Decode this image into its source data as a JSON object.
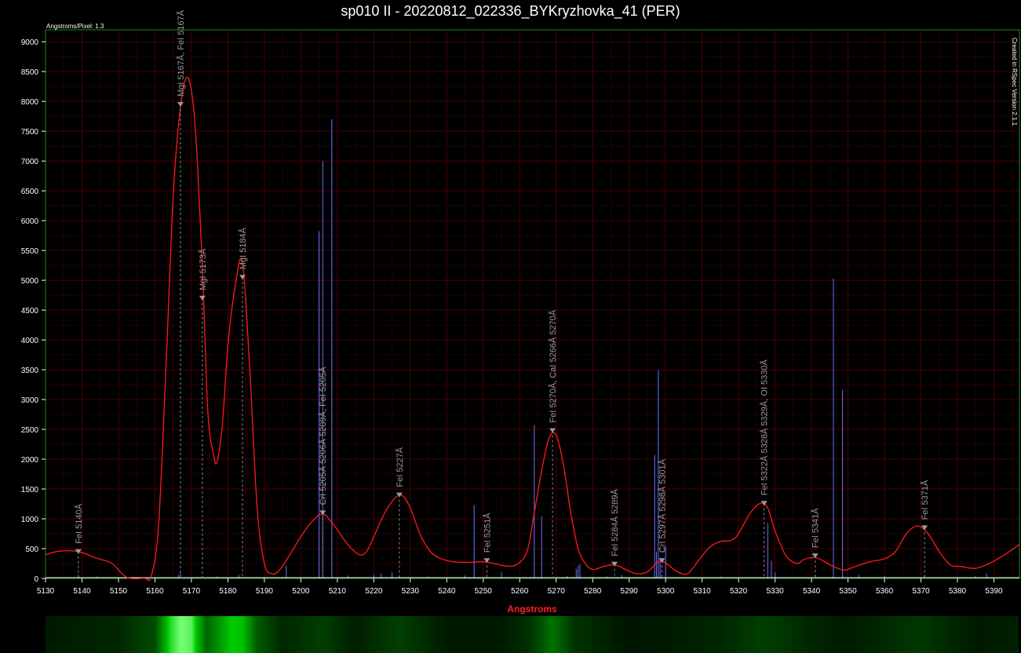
{
  "title": "sp010 II - 20220812_022336_BYKryzhovka_41 (PER)",
  "corner_note": "Angstroms/Pixel: 1.3",
  "side_note": "Created in RSpec Version 2.1.1",
  "colors": {
    "background": "#000000",
    "grid": "#3a0000",
    "spectrum": "#ff1a1a",
    "lines": "#7070ff",
    "axis_label": "#ff2020",
    "markers": "#8a8a8a",
    "frame": "#1f8a1f"
  },
  "chart_data": {
    "type": "line",
    "xlabel": "Angstroms",
    "ylabel": "",
    "xlim": [
      5130,
      5397
    ],
    "ylim": [
      0,
      9200
    ],
    "x_ticks": [
      5130,
      5140,
      5150,
      5160,
      5170,
      5180,
      5190,
      5200,
      5210,
      5220,
      5230,
      5240,
      5250,
      5260,
      5270,
      5280,
      5290,
      5300,
      5310,
      5320,
      5330,
      5340,
      5350,
      5360,
      5370,
      5380,
      5390
    ],
    "y_ticks": [
      0,
      500,
      1000,
      1500,
      2000,
      2500,
      3000,
      3500,
      4000,
      4500,
      5000,
      5500,
      6000,
      6500,
      7000,
      7500,
      8000,
      8500,
      9000
    ],
    "grid": true,
    "spectrum": [
      [
        5130,
        400
      ],
      [
        5134,
        460
      ],
      [
        5139,
        450
      ],
      [
        5144,
        340
      ],
      [
        5148,
        260
      ],
      [
        5151,
        80
      ],
      [
        5153,
        5
      ],
      [
        5157,
        5
      ],
      [
        5159,
        40
      ],
      [
        5161,
        900
      ],
      [
        5163,
        3500
      ],
      [
        5165,
        6400
      ],
      [
        5167,
        7900
      ],
      [
        5169,
        8400
      ],
      [
        5171,
        7600
      ],
      [
        5173,
        5200
      ],
      [
        5174.5,
        2800
      ],
      [
        5176,
        2100
      ],
      [
        5177,
        1950
      ],
      [
        5178.5,
        2600
      ],
      [
        5180,
        3900
      ],
      [
        5182,
        4900
      ],
      [
        5184,
        5300
      ],
      [
        5186,
        3500
      ],
      [
        5188,
        1200
      ],
      [
        5190,
        250
      ],
      [
        5192,
        80
      ],
      [
        5194,
        130
      ],
      [
        5197,
        400
      ],
      [
        5200,
        700
      ],
      [
        5203,
        950
      ],
      [
        5206,
        1080
      ],
      [
        5209,
        900
      ],
      [
        5213,
        560
      ],
      [
        5216,
        400
      ],
      [
        5218,
        450
      ],
      [
        5220,
        700
      ],
      [
        5223,
        1100
      ],
      [
        5226,
        1360
      ],
      [
        5228,
        1380
      ],
      [
        5230,
        1180
      ],
      [
        5233,
        700
      ],
      [
        5236,
        420
      ],
      [
        5240,
        300
      ],
      [
        5245,
        270
      ],
      [
        5250,
        280
      ],
      [
        5253,
        250
      ],
      [
        5256,
        210
      ],
      [
        5259,
        230
      ],
      [
        5262,
        450
      ],
      [
        5264,
        1100
      ],
      [
        5266,
        1800
      ],
      [
        5268,
        2350
      ],
      [
        5270,
        2400
      ],
      [
        5272,
        1900
      ],
      [
        5274,
        1100
      ],
      [
        5276,
        500
      ],
      [
        5278,
        250
      ],
      [
        5280,
        150
      ],
      [
        5283,
        200
      ],
      [
        5286,
        230
      ],
      [
        5289,
        150
      ],
      [
        5292,
        80
      ],
      [
        5295,
        110
      ],
      [
        5298,
        280
      ],
      [
        5300,
        260
      ],
      [
        5303,
        120
      ],
      [
        5306,
        80
      ],
      [
        5309,
        300
      ],
      [
        5312,
        520
      ],
      [
        5315,
        620
      ],
      [
        5318,
        640
      ],
      [
        5320,
        750
      ],
      [
        5323,
        1080
      ],
      [
        5326,
        1260
      ],
      [
        5328,
        1180
      ],
      [
        5330,
        800
      ],
      [
        5333,
        380
      ],
      [
        5336,
        250
      ],
      [
        5338,
        320
      ],
      [
        5341,
        350
      ],
      [
        5343,
        300
      ],
      [
        5346,
        200
      ],
      [
        5349,
        140
      ],
      [
        5352,
        200
      ],
      [
        5356,
        280
      ],
      [
        5360,
        330
      ],
      [
        5363,
        450
      ],
      [
        5366,
        750
      ],
      [
        5369,
        880
      ],
      [
        5372,
        750
      ],
      [
        5375,
        450
      ],
      [
        5378,
        230
      ],
      [
        5381,
        200
      ],
      [
        5385,
        170
      ],
      [
        5389,
        260
      ],
      [
        5393,
        400
      ],
      [
        5397,
        570
      ]
    ],
    "lab_lines": [
      [
        5139,
        60
      ],
      [
        5144,
        30
      ],
      [
        5166.5,
        60
      ],
      [
        5167,
        100
      ],
      [
        5177,
        30
      ],
      [
        5183,
        60
      ],
      [
        5196,
        220
      ],
      [
        5205,
        5820
      ],
      [
        5206,
        7000
      ],
      [
        5208.5,
        7700
      ],
      [
        5213,
        50
      ],
      [
        5220,
        60
      ],
      [
        5222,
        80
      ],
      [
        5225,
        100
      ],
      [
        5227,
        40
      ],
      [
        5235,
        30
      ],
      [
        5245,
        50
      ],
      [
        5247.5,
        1230
      ],
      [
        5255,
        100
      ],
      [
        5264,
        2570
      ],
      [
        5266,
        1040
      ],
      [
        5273,
        40
      ],
      [
        5275.5,
        160
      ],
      [
        5276,
        210
      ],
      [
        5276.5,
        240
      ],
      [
        5284,
        30
      ],
      [
        5288,
        60
      ],
      [
        5297,
        2070
      ],
      [
        5297.5,
        450
      ],
      [
        5298,
        3500
      ],
      [
        5298.5,
        350
      ],
      [
        5300,
        540
      ],
      [
        5315,
        30
      ],
      [
        5328,
        930
      ],
      [
        5329,
        300
      ],
      [
        5330,
        100
      ],
      [
        5346,
        5030
      ],
      [
        5348.5,
        3160
      ],
      [
        5353,
        60
      ],
      [
        5360,
        40
      ],
      [
        5371,
        50
      ],
      [
        5385,
        40
      ],
      [
        5388,
        80
      ]
    ],
    "annotations": [
      {
        "x": 5139,
        "y": 450,
        "label": "FeI 5140Å"
      },
      {
        "x": 5167,
        "y": 7950,
        "label": "MgI 5167Å, FeI 5167Å"
      },
      {
        "x": 5173,
        "y": 4700,
        "label": "MgI 5173Å"
      },
      {
        "x": 5184,
        "y": 5050,
        "label": "MgI 5184Å"
      },
      {
        "x": 5206,
        "y": 1100,
        "label": "CrI 5205Å 5206Å 5209Å, FeI 5205Å"
      },
      {
        "x": 5227,
        "y": 1400,
        "label": "FeI 5227Å"
      },
      {
        "x": 5251,
        "y": 300,
        "label": "FeI 5251Å"
      },
      {
        "x": 5269,
        "y": 2480,
        "label": "FeI 5270Å, CaI 5266Å 5270Å"
      },
      {
        "x": 5286,
        "y": 240,
        "label": "FeI 5284Å 5289Å"
      },
      {
        "x": 5299,
        "y": 300,
        "label": "CrI 5297Å 5298Å 5301Å"
      },
      {
        "x": 5327,
        "y": 1260,
        "label": "FeI 5322Å 5328Å 5329Å, OI 5330Å"
      },
      {
        "x": 5341,
        "y": 380,
        "label": "FeI 5341Å"
      },
      {
        "x": 5371,
        "y": 850,
        "label": "FeI 5371Å"
      }
    ],
    "strip_intensity": [
      [
        5130,
        0.1
      ],
      [
        5150,
        0.15
      ],
      [
        5160,
        0.3
      ],
      [
        5164,
        0.85
      ],
      [
        5167,
        1.0
      ],
      [
        5170,
        0.95
      ],
      [
        5174,
        0.4
      ],
      [
        5177,
        0.55
      ],
      [
        5181,
        0.8
      ],
      [
        5184,
        0.75
      ],
      [
        5188,
        0.35
      ],
      [
        5195,
        0.15
      ],
      [
        5206,
        0.25
      ],
      [
        5215,
        0.12
      ],
      [
        5227,
        0.25
      ],
      [
        5240,
        0.1
      ],
      [
        5255,
        0.1
      ],
      [
        5263,
        0.2
      ],
      [
        5269,
        0.45
      ],
      [
        5275,
        0.2
      ],
      [
        5290,
        0.08
      ],
      [
        5300,
        0.1
      ],
      [
        5315,
        0.15
      ],
      [
        5327,
        0.25
      ],
      [
        5340,
        0.15
      ],
      [
        5350,
        0.1
      ],
      [
        5370,
        0.22
      ],
      [
        5385,
        0.1
      ],
      [
        5397,
        0.12
      ]
    ]
  }
}
